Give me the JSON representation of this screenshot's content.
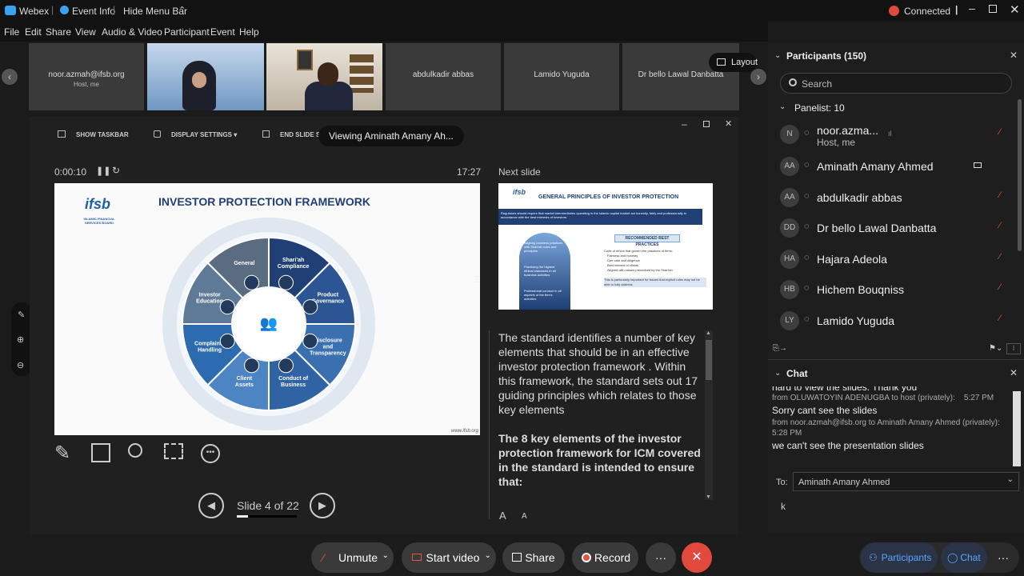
{
  "titlebar": {
    "app": "Webex",
    "event_info": "Event Info",
    "hide_menu": "Hide Menu Bar",
    "status": "Connected"
  },
  "menu": [
    "File",
    "Edit",
    "Share",
    "View",
    "Audio & Video",
    "Participant",
    "Event",
    "Help"
  ],
  "thumbnails": [
    {
      "name": "noor.azmah@ifsb.org",
      "sub": "Host, me"
    },
    {
      "name": "",
      "sub": ""
    },
    {
      "name": "",
      "sub": ""
    },
    {
      "name": "abdulkadir abbas",
      "sub": ""
    },
    {
      "name": "Lamido Yuguda",
      "sub": ""
    },
    {
      "name": "Dr bello Lawal Danbatta",
      "sub": ""
    }
  ],
  "layout_btn": "Layout",
  "presenter": {
    "show_taskbar": "SHOW TASKBAR",
    "display_settings": "DISPLAY SETTINGS ▾",
    "end_slideshow": "END SLIDE SI",
    "viewing_tooltip": "Viewing Aminath Amany Ah...",
    "timer": "0:00:10",
    "clock": "17:27",
    "next_slide_label": "Next slide",
    "slide_counter": "Slide 4 of 22",
    "progress": 0.18
  },
  "slide": {
    "title": "INVESTOR PROTECTION FRAMEWORK",
    "logo": "ifsb",
    "logo_sub": "ISLAMIC FINANCIAL SERVICES BOARD",
    "segments": [
      "General",
      "Shari'ah Compliance",
      "Product Governance",
      "Disclosure and Transparency",
      "Conduct of Business",
      "Client Assets",
      "Complaints Handling",
      "Investor Education"
    ],
    "footer": "www.ifsb.org"
  },
  "next_slide": {
    "title": "GENERAL PRINCIPLES OF INVESTOR PROTECTION",
    "banner": "Regulators should require that market intermediaries operating in the Islamic capital market act honestly, fairly and professionally in accordance with the best interests of investors.",
    "box_title": "RECOMMENDED BEST PRACTICES",
    "head_labels": [
      "Aligning business practices with Shari'ah rules and principles",
      "Practising the highest ethical standards in all business activities",
      "Professional conduct in all aspects of the firm's activities"
    ],
    "lines": [
      "Code of ethics that govern the practices of firms:",
      "Fairness and honesty",
      "Due care and diligence",
      "Best interest of clients",
      "Aligned with values prescribed by the Shari'ah",
      "This is particularly important for issues that explicit rules may not be able to fully address"
    ]
  },
  "notes": {
    "para1": "The standard identifies a number of key elements that should be in an effective investor protection framework . Within this framework, the standard sets out 17 guiding principles which relates to those key elements",
    "para2": "The 8 key elements of the investor protection framework for ICM covered in the standard is intended to ensure that:"
  },
  "participants": {
    "header": "Participants (150)",
    "search_placeholder": "Search",
    "panelist_header": "Panelist: 10",
    "list": [
      {
        "initials": "N",
        "name": "noor.azma...",
        "sub": "Host, me"
      },
      {
        "initials": "AA",
        "name": "Aminath Amany Ahmed",
        "sub": ""
      },
      {
        "initials": "AA",
        "name": "abdulkadir abbas",
        "sub": ""
      },
      {
        "initials": "DD",
        "name": "Dr bello Lawal Danbatta",
        "sub": ""
      },
      {
        "initials": "HA",
        "name": "Hajara Adeola",
        "sub": ""
      },
      {
        "initials": "HB",
        "name": "Hichem Bouqniss",
        "sub": ""
      },
      {
        "initials": "LY",
        "name": "Lamido Yuguda",
        "sub": ""
      }
    ]
  },
  "chat": {
    "header": "Chat",
    "messages": [
      {
        "type": "text",
        "text": "hard to view the slides. Thank you"
      },
      {
        "type": "meta",
        "text": "from OLUWATOYIN ADENUGBA to host (privately):",
        "time": "5:27 PM"
      },
      {
        "type": "text",
        "text": "Sorry cant see the slides"
      },
      {
        "type": "meta",
        "text": "from noor.azmah@ifsb.org to Aminath Amany Ahmed (privately):",
        "time": ""
      },
      {
        "type": "meta",
        "text": "5:28 PM",
        "time": ""
      },
      {
        "type": "text",
        "text": "we can't see the presentation slides"
      }
    ],
    "to_label": "To:",
    "to_value": "Aminath Amany Ahmed",
    "input_value": "k"
  },
  "controls": {
    "unmute": "Unmute",
    "start_video": "Start video",
    "share": "Share",
    "record": "Record",
    "more": "···",
    "participants": "Participants",
    "chat": "Chat"
  }
}
